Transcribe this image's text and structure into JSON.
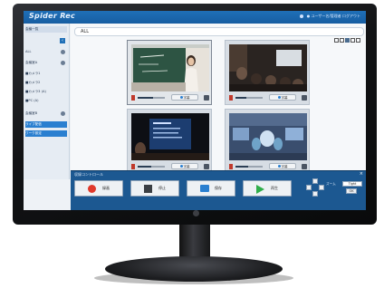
{
  "app": {
    "logo_text": "Spider Rec",
    "user_text": "● ユーザー名/管理者 ログアウト",
    "accent_color": "#1f6fb7"
  },
  "sidebar": {
    "items": [
      {
        "label": "会議一覧",
        "style": "head"
      },
      {
        "label": "ALL",
        "style": "row"
      },
      {
        "label": "会議室A",
        "style": "row"
      },
      {
        "label": "■カメラ1",
        "style": "row"
      },
      {
        "label": "■カメラ2",
        "style": "row"
      },
      {
        "label": "■カメラ3 (A)",
        "style": "row"
      },
      {
        "label": "■PC (A)",
        "style": "row"
      },
      {
        "label": "会議室B",
        "style": "row"
      },
      {
        "label": "ライブ配信",
        "style": "sel"
      },
      {
        "label": "ワーク設定",
        "style": "sel"
      }
    ]
  },
  "filter": {
    "label": "ALL"
  },
  "tiles": [
    {
      "subtitle_label": "字幕",
      "volume": 0.55,
      "selected": true,
      "scene": "lecture"
    },
    {
      "subtitle_label": "字幕",
      "volume": 0.4,
      "selected": false,
      "scene": "audience"
    },
    {
      "subtitle_label": "字幕",
      "volume": 0.5,
      "selected": false,
      "scene": "presentation"
    },
    {
      "subtitle_label": "字幕",
      "volume": 0.45,
      "selected": false,
      "scene": "operating-room"
    }
  ],
  "panel": {
    "title": "収録コントロール",
    "record_label": "録画",
    "stop_label": "停止",
    "save_label": "保存",
    "play_label": "再生",
    "zoom_label": "ズーム",
    "zoom_value": "Tight",
    "zoom_button": "OK"
  }
}
